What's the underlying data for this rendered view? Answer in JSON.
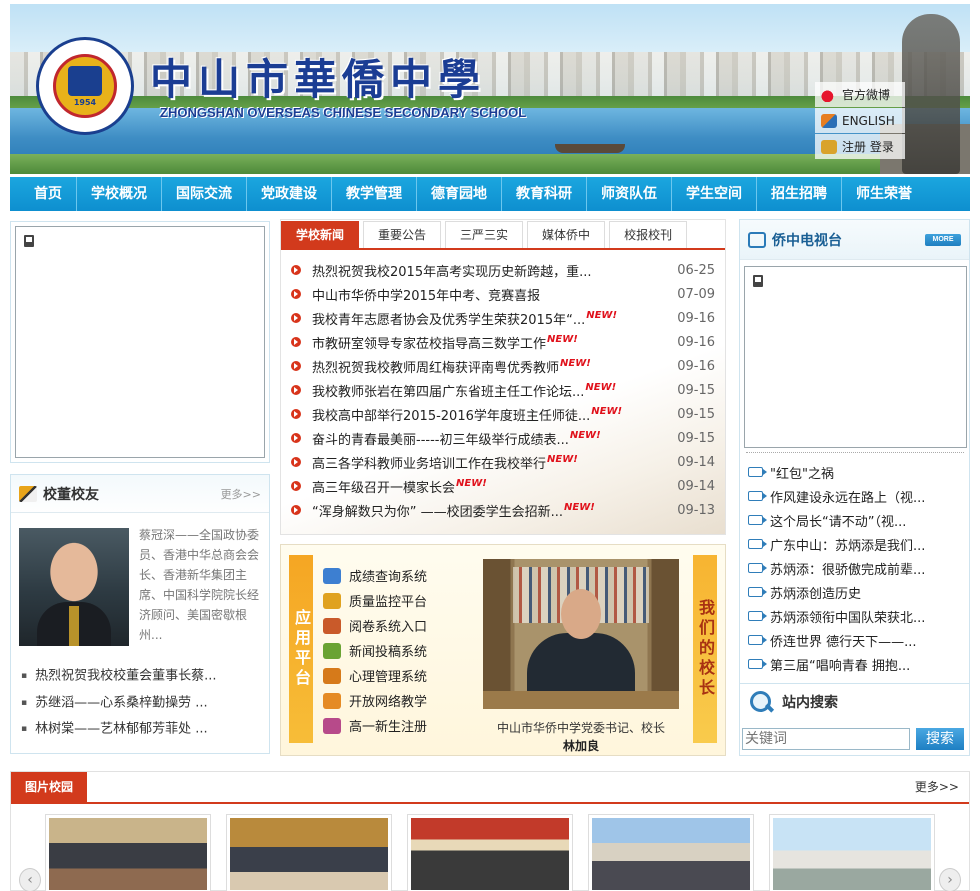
{
  "header": {
    "school_name_cn": "中山市華僑中學",
    "school_name_en": "ZHONGSHAN OVERSEAS CHINESE SECONDARY SCHOOL",
    "logo_year": "1954",
    "quick_links": [
      {
        "label": "官方微博",
        "icon": "weibo-icon"
      },
      {
        "label": "ENGLISH",
        "icon": "english-icon"
      },
      {
        "label": "注册 登录",
        "icon": "login-icon"
      }
    ]
  },
  "nav": {
    "items": [
      "首页",
      "学校概况",
      "国际交流",
      "党政建设",
      "教学管理",
      "德育园地",
      "教育科研",
      "师资队伍",
      "学生空间",
      "招生招聘",
      "师生荣誉"
    ]
  },
  "alumni": {
    "title": "校董校友",
    "more": "更多>>",
    "bio": "蔡冠深——全国政协委员、香港中华总商会会长、香港新华集团主席、中国科学院院长经济顾问、美国密歇根州...",
    "items": [
      "热烈祝贺我校校董会董事长蔡...",
      "苏继滔——心系桑梓勤操劳 ...",
      "林树棠——艺林郁郁芳菲处 ..."
    ]
  },
  "news": {
    "tabs": [
      "学校新闻",
      "重要公告",
      "三严三实",
      "媒体侨中",
      "校报校刊"
    ],
    "new_badge": "NEW!",
    "items": [
      {
        "title": "热烈祝贺我校2015年高考实现历史新跨越，重...",
        "date": "06-25",
        "is_new": false
      },
      {
        "title": "中山市华侨中学2015年中考、竞赛喜报",
        "date": "07-09",
        "is_new": false
      },
      {
        "title": "我校青年志愿者协会及优秀学生荣获2015年“...",
        "date": "09-16",
        "is_new": true
      },
      {
        "title": "市教研室领导专家莅校指导高三数学工作",
        "date": "09-16",
        "is_new": true
      },
      {
        "title": "热烈祝贺我校教师周红梅获评南粤优秀教师",
        "date": "09-16",
        "is_new": true
      },
      {
        "title": "我校教师张岩在第四届广东省班主任工作论坛...",
        "date": "09-15",
        "is_new": true
      },
      {
        "title": "我校高中部举行2015-2016学年度班主任师徒...",
        "date": "09-15",
        "is_new": true
      },
      {
        "title": "奋斗的青春最美丽-----初三年级举行成绩表...",
        "date": "09-15",
        "is_new": true
      },
      {
        "title": "高三各学科教师业务培训工作在我校举行",
        "date": "09-14",
        "is_new": true
      },
      {
        "title": "高三年级召开一模家长会",
        "date": "09-14",
        "is_new": true
      },
      {
        "title": "“浑身解数只为你” ——校团委学生会招新...",
        "date": "09-13",
        "is_new": true
      }
    ]
  },
  "platform": {
    "left_label": "应用平台",
    "right_label": "我们的校长",
    "apps": [
      {
        "label": "成绩查询系统",
        "color": "#3d7fd1"
      },
      {
        "label": "质量监控平台",
        "color": "#e0a21f"
      },
      {
        "label": "阅卷系统入口",
        "color": "#c95a2a"
      },
      {
        "label": "新闻投稿系统",
        "color": "#6aa333"
      },
      {
        "label": "心理管理系统",
        "color": "#d67a1a"
      },
      {
        "label": "开放网络教学",
        "color": "#e58b24"
      },
      {
        "label": "高一新生注册",
        "color": "#b74a8a"
      }
    ],
    "principal_caption": "中山市华侨中学党委书记、校长",
    "principal_name": "林加良"
  },
  "tv": {
    "title": "侨中电视台",
    "more": "MORE",
    "items": [
      "\"红包\"之祸",
      "作风建设永远在路上（视...",
      "这个局长“请不动”（视...",
      "广东中山：苏炳添是我们...",
      "苏炳添：很骄傲完成前辈...",
      "苏炳添创造历史",
      "苏炳添领衔中国队荣获北...",
      "侨连世界 德行天下——...",
      "第三届“唱响青春 拥抱..."
    ]
  },
  "search": {
    "title": "站内搜索",
    "placeholder": "关键词",
    "button": "搜索"
  },
  "campus": {
    "title": "图片校园",
    "more": "更多>>"
  }
}
